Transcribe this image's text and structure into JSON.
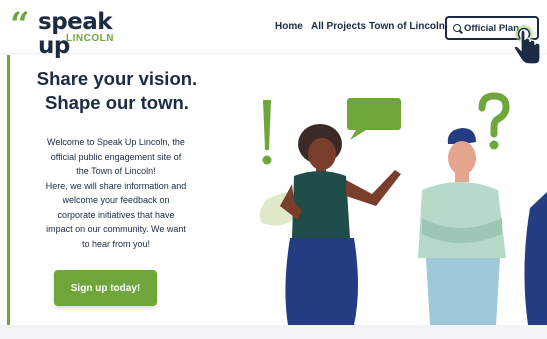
{
  "header": {
    "logo": {
      "quote_mark": "“",
      "name": "speak up",
      "town": "LINCOLN"
    },
    "nav": [
      "Home",
      "All Projects",
      "Town of Lincoln"
    ],
    "search_button": {
      "label": "Official Plan",
      "icon": "search-icon"
    }
  },
  "hero": {
    "title_lines": [
      "Share your vision.",
      "Shape our town."
    ],
    "body_lines": [
      "Welcome to Speak Up Lincoln, the",
      "official public engagement site of",
      "the Town of Lincoln!",
      "Here, we will share information and",
      "welcome your feedback on",
      "corporate initiatives that have",
      "impact on our community. We want",
      "to hear from you!"
    ],
    "cta": "Sign up today!"
  },
  "illustration": {
    "symbols": [
      "!",
      "?"
    ],
    "icons": [
      "exclamation-icon",
      "speech-bubble-icon",
      "question-icon",
      "woman-figure",
      "man-figure"
    ]
  },
  "colors": {
    "brand_green": "#6ea63a",
    "navy": "#1c2b44",
    "background": "#ffffff"
  }
}
